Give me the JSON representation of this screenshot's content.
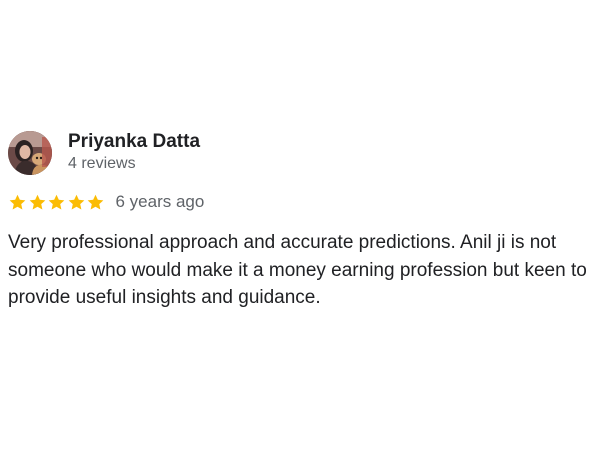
{
  "review": {
    "author_name": "Priyanka Datta",
    "author_meta": "4 reviews",
    "rating": 5,
    "rating_max": 5,
    "star_color": "#fbbc04",
    "timestamp": "6 years ago",
    "text": "Very professional approach and accurate predictions. Anil ji is not someone who would make it a money earning profession but keen to provide useful insights and guidance."
  }
}
